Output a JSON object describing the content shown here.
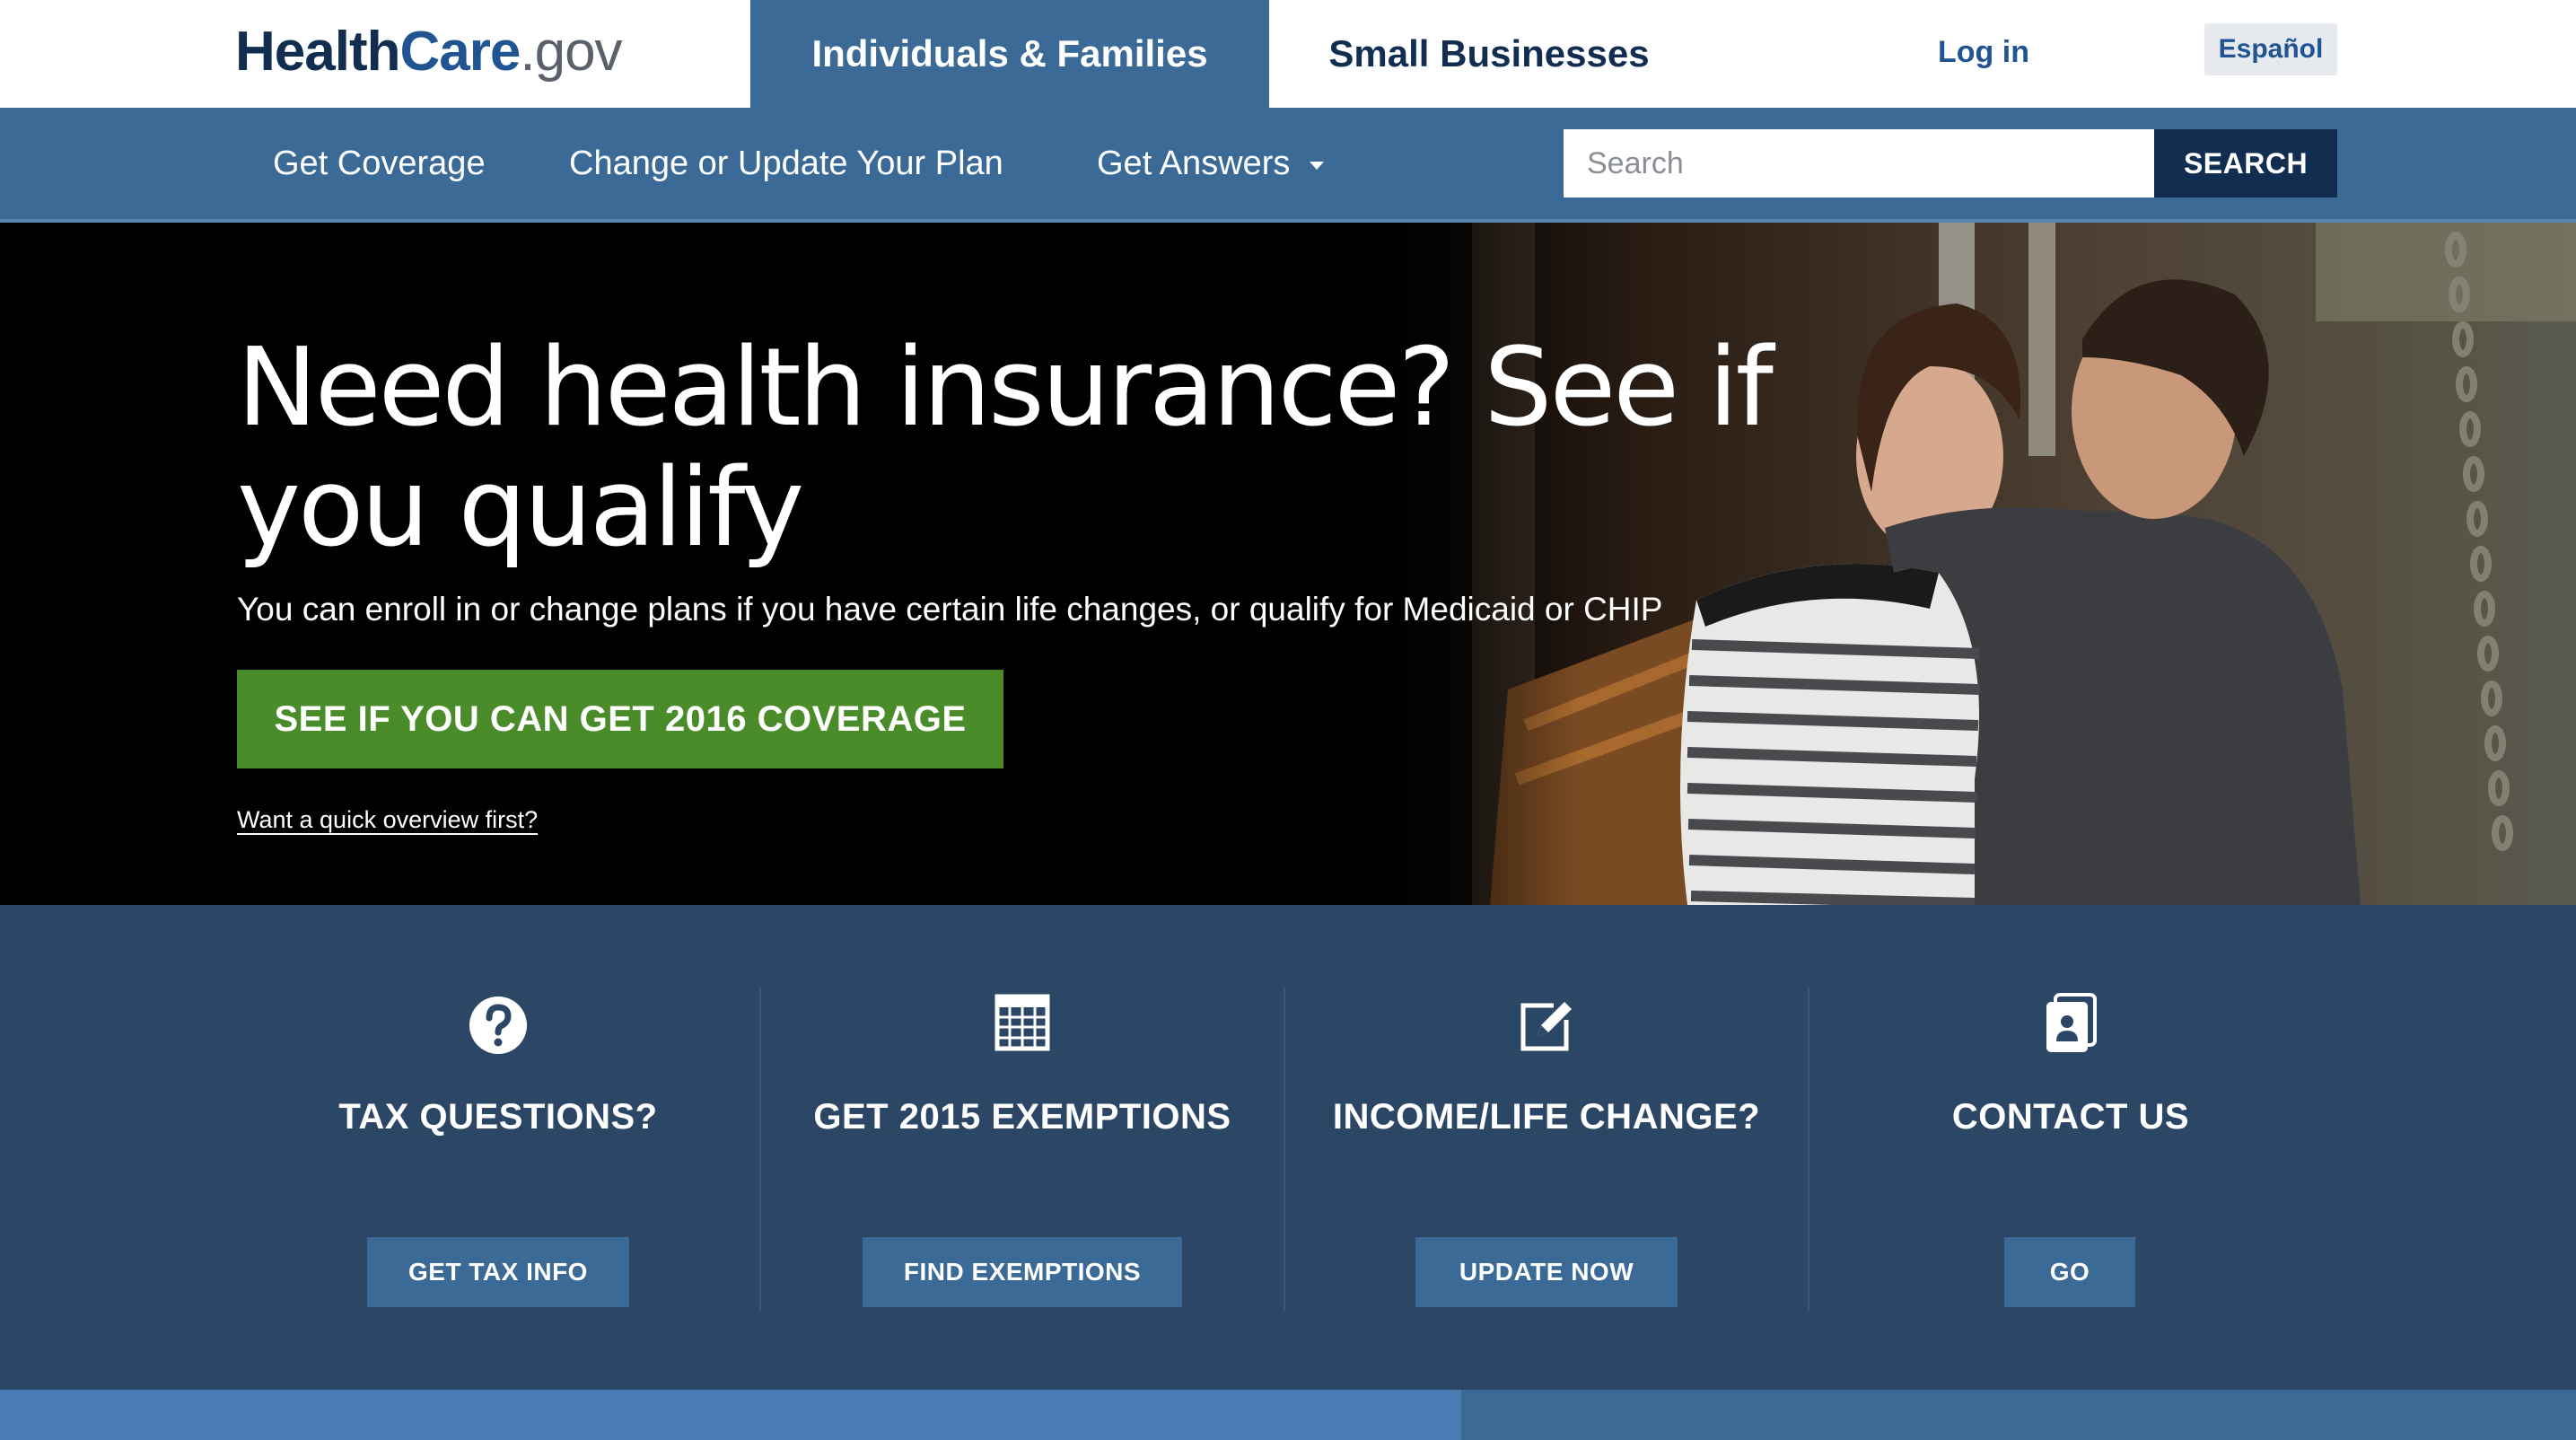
{
  "header": {
    "logo": {
      "part1": "Health",
      "part2": "Care",
      "part3": ".gov"
    },
    "tabs": {
      "individuals": "Individuals & Families",
      "business": "Small Businesses"
    },
    "login": "Log in",
    "language": "Español"
  },
  "nav": {
    "items": [
      "Get Coverage",
      "Change or Update Your Plan",
      "Get Answers"
    ],
    "search": {
      "placeholder": "Search",
      "value": "",
      "button": "SEARCH"
    }
  },
  "hero": {
    "title": "Need health insurance? See if you qualify",
    "subtitle": "You can enroll in or change plans if you have certain life changes, or qualify for Medicaid or CHIP",
    "cta": "SEE IF YOU CAN GET 2016 COVERAGE",
    "link": "Want a quick overview first?"
  },
  "cards": [
    {
      "icon": "question-circle-icon",
      "title": "TAX QUESTIONS?",
      "button": "GET TAX INFO"
    },
    {
      "icon": "table-grid-icon",
      "title": "GET 2015 EXEMPTIONS",
      "button": "FIND EXEMPTIONS"
    },
    {
      "icon": "edit-pencil-icon",
      "title": "INCOME/LIFE CHANGE?",
      "button": "UPDATE NOW"
    },
    {
      "icon": "contact-card-icon",
      "title": "CONTACT US",
      "button": "GO"
    }
  ],
  "colors": {
    "brand_dark": "#112e51",
    "brand_blue": "#205493",
    "nav_blue": "#3b6a96",
    "band_navy": "#2c4766",
    "cta_green": "#4a8c2a"
  }
}
